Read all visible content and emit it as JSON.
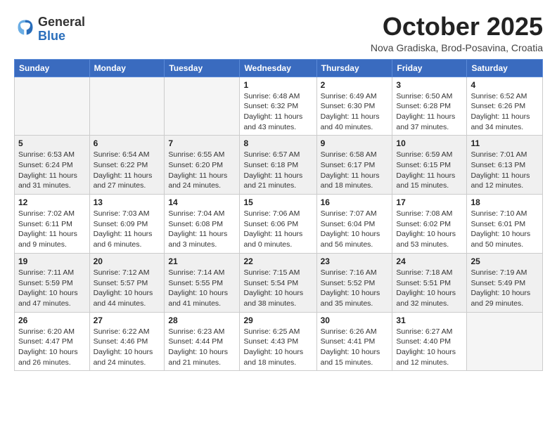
{
  "logo": {
    "general": "General",
    "blue": "Blue"
  },
  "header": {
    "month": "October 2025",
    "location": "Nova Gradiska, Brod-Posavina, Croatia"
  },
  "days_of_week": [
    "Sunday",
    "Monday",
    "Tuesday",
    "Wednesday",
    "Thursday",
    "Friday",
    "Saturday"
  ],
  "weeks": [
    {
      "shaded": false,
      "days": [
        {
          "num": "",
          "info": ""
        },
        {
          "num": "",
          "info": ""
        },
        {
          "num": "",
          "info": ""
        },
        {
          "num": "1",
          "info": "Sunrise: 6:48 AM\nSunset: 6:32 PM\nDaylight: 11 hours\nand 43 minutes."
        },
        {
          "num": "2",
          "info": "Sunrise: 6:49 AM\nSunset: 6:30 PM\nDaylight: 11 hours\nand 40 minutes."
        },
        {
          "num": "3",
          "info": "Sunrise: 6:50 AM\nSunset: 6:28 PM\nDaylight: 11 hours\nand 37 minutes."
        },
        {
          "num": "4",
          "info": "Sunrise: 6:52 AM\nSunset: 6:26 PM\nDaylight: 11 hours\nand 34 minutes."
        }
      ]
    },
    {
      "shaded": true,
      "days": [
        {
          "num": "5",
          "info": "Sunrise: 6:53 AM\nSunset: 6:24 PM\nDaylight: 11 hours\nand 31 minutes."
        },
        {
          "num": "6",
          "info": "Sunrise: 6:54 AM\nSunset: 6:22 PM\nDaylight: 11 hours\nand 27 minutes."
        },
        {
          "num": "7",
          "info": "Sunrise: 6:55 AM\nSunset: 6:20 PM\nDaylight: 11 hours\nand 24 minutes."
        },
        {
          "num": "8",
          "info": "Sunrise: 6:57 AM\nSunset: 6:18 PM\nDaylight: 11 hours\nand 21 minutes."
        },
        {
          "num": "9",
          "info": "Sunrise: 6:58 AM\nSunset: 6:17 PM\nDaylight: 11 hours\nand 18 minutes."
        },
        {
          "num": "10",
          "info": "Sunrise: 6:59 AM\nSunset: 6:15 PM\nDaylight: 11 hours\nand 15 minutes."
        },
        {
          "num": "11",
          "info": "Sunrise: 7:01 AM\nSunset: 6:13 PM\nDaylight: 11 hours\nand 12 minutes."
        }
      ]
    },
    {
      "shaded": false,
      "days": [
        {
          "num": "12",
          "info": "Sunrise: 7:02 AM\nSunset: 6:11 PM\nDaylight: 11 hours\nand 9 minutes."
        },
        {
          "num": "13",
          "info": "Sunrise: 7:03 AM\nSunset: 6:09 PM\nDaylight: 11 hours\nand 6 minutes."
        },
        {
          "num": "14",
          "info": "Sunrise: 7:04 AM\nSunset: 6:08 PM\nDaylight: 11 hours\nand 3 minutes."
        },
        {
          "num": "15",
          "info": "Sunrise: 7:06 AM\nSunset: 6:06 PM\nDaylight: 11 hours\nand 0 minutes."
        },
        {
          "num": "16",
          "info": "Sunrise: 7:07 AM\nSunset: 6:04 PM\nDaylight: 10 hours\nand 56 minutes."
        },
        {
          "num": "17",
          "info": "Sunrise: 7:08 AM\nSunset: 6:02 PM\nDaylight: 10 hours\nand 53 minutes."
        },
        {
          "num": "18",
          "info": "Sunrise: 7:10 AM\nSunset: 6:01 PM\nDaylight: 10 hours\nand 50 minutes."
        }
      ]
    },
    {
      "shaded": true,
      "days": [
        {
          "num": "19",
          "info": "Sunrise: 7:11 AM\nSunset: 5:59 PM\nDaylight: 10 hours\nand 47 minutes."
        },
        {
          "num": "20",
          "info": "Sunrise: 7:12 AM\nSunset: 5:57 PM\nDaylight: 10 hours\nand 44 minutes."
        },
        {
          "num": "21",
          "info": "Sunrise: 7:14 AM\nSunset: 5:55 PM\nDaylight: 10 hours\nand 41 minutes."
        },
        {
          "num": "22",
          "info": "Sunrise: 7:15 AM\nSunset: 5:54 PM\nDaylight: 10 hours\nand 38 minutes."
        },
        {
          "num": "23",
          "info": "Sunrise: 7:16 AM\nSunset: 5:52 PM\nDaylight: 10 hours\nand 35 minutes."
        },
        {
          "num": "24",
          "info": "Sunrise: 7:18 AM\nSunset: 5:51 PM\nDaylight: 10 hours\nand 32 minutes."
        },
        {
          "num": "25",
          "info": "Sunrise: 7:19 AM\nSunset: 5:49 PM\nDaylight: 10 hours\nand 29 minutes."
        }
      ]
    },
    {
      "shaded": false,
      "days": [
        {
          "num": "26",
          "info": "Sunrise: 6:20 AM\nSunset: 4:47 PM\nDaylight: 10 hours\nand 26 minutes."
        },
        {
          "num": "27",
          "info": "Sunrise: 6:22 AM\nSunset: 4:46 PM\nDaylight: 10 hours\nand 24 minutes."
        },
        {
          "num": "28",
          "info": "Sunrise: 6:23 AM\nSunset: 4:44 PM\nDaylight: 10 hours\nand 21 minutes."
        },
        {
          "num": "29",
          "info": "Sunrise: 6:25 AM\nSunset: 4:43 PM\nDaylight: 10 hours\nand 18 minutes."
        },
        {
          "num": "30",
          "info": "Sunrise: 6:26 AM\nSunset: 4:41 PM\nDaylight: 10 hours\nand 15 minutes."
        },
        {
          "num": "31",
          "info": "Sunrise: 6:27 AM\nSunset: 4:40 PM\nDaylight: 10 hours\nand 12 minutes."
        },
        {
          "num": "",
          "info": ""
        }
      ]
    }
  ]
}
